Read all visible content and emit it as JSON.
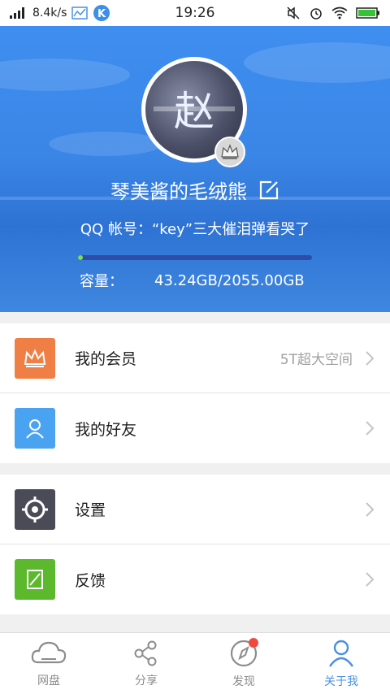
{
  "status_bar": {
    "speed": "8.4k/s",
    "time": "19:26"
  },
  "profile": {
    "avatar_glyph": "赵",
    "nickname": "琴美酱的毛绒熊",
    "qq_account": "QQ 帐号：“key”三大催泪弹看哭了",
    "capacity_label": "容量：",
    "capacity_value": "43.24GB/2055.00GB",
    "capacity_fraction": 0.021
  },
  "menu_group_1": [
    {
      "label": "我的会员",
      "extra": "5T超大空间",
      "icon": "crown-icon",
      "color": "#f07f45"
    },
    {
      "label": "我的好友",
      "extra": "",
      "icon": "person-icon",
      "color": "#4aa3f0"
    }
  ],
  "menu_group_2": [
    {
      "label": "设置",
      "icon": "gear-icon",
      "color": "#4a4b57"
    },
    {
      "label": "反馈",
      "icon": "feedback-icon",
      "color": "#5cb82c"
    }
  ],
  "tabs": [
    {
      "label": "网盘",
      "icon": "cloud-icon",
      "active": false
    },
    {
      "label": "分享",
      "icon": "share-icon",
      "active": false
    },
    {
      "label": "发现",
      "icon": "compass-icon",
      "active": false,
      "badge": true
    },
    {
      "label": "关于我",
      "icon": "person-icon",
      "active": true
    }
  ],
  "colors": {
    "accent": "#4a90e2",
    "header_blue": "#3a86e6",
    "badge_red": "#f04a40",
    "progress_green": "#7fe04a"
  }
}
